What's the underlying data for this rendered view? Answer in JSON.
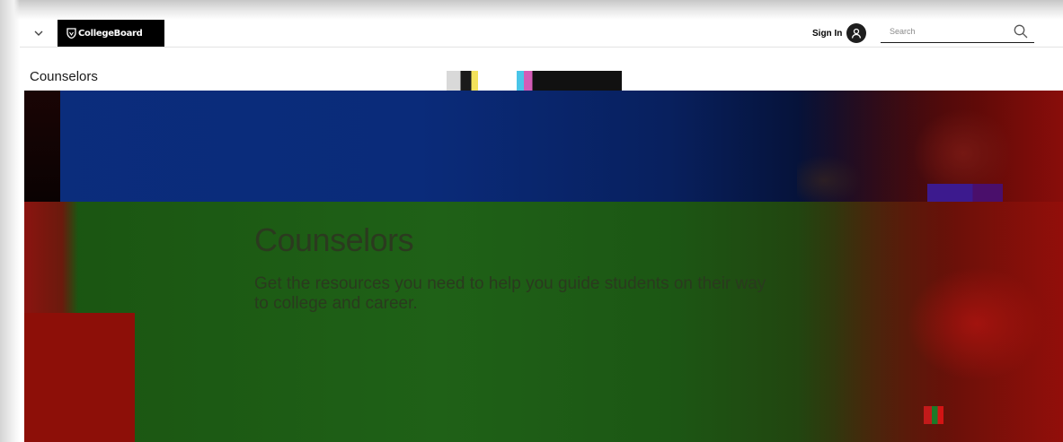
{
  "header": {
    "brand": "CollegeBoard",
    "signin_label": "Sign In",
    "search_placeholder": "Search"
  },
  "page": {
    "title": "Counselors"
  },
  "hero": {
    "headline": "Counselors",
    "subtitle": "Get the resources you need to help you guide students on their way to college and career."
  },
  "icons": {
    "menu": "chevron-down-icon",
    "logo": "acorn-shield-icon",
    "user": "user-icon",
    "search": "search-icon"
  },
  "colors": {
    "brand_black": "#000000",
    "hero_blue": "#0b2d7c",
    "hero_green": "#1f6117",
    "hero_red": "#8d0f08"
  }
}
